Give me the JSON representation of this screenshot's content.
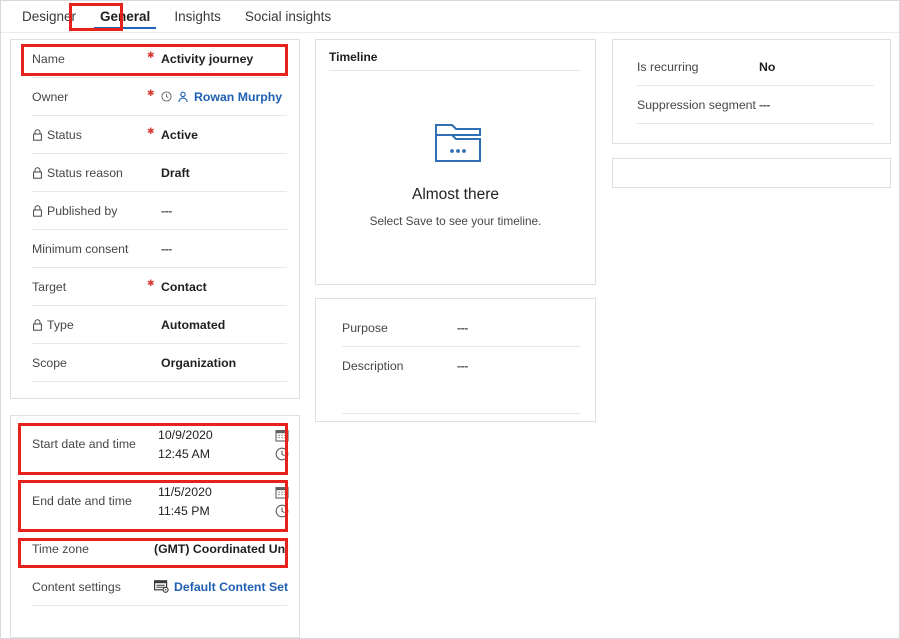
{
  "tabs": [
    {
      "label": "Designer",
      "active": false
    },
    {
      "label": "General",
      "active": true
    },
    {
      "label": "Insights",
      "active": false
    },
    {
      "label": "Social insights",
      "active": false
    }
  ],
  "general_card": {
    "fields": [
      {
        "label": "Name",
        "locked": false,
        "required": true,
        "value": "Activity journey",
        "style": "bold"
      },
      {
        "label": "Owner",
        "locked": false,
        "required": true,
        "value": "Rowan Murphy",
        "style": "link"
      },
      {
        "label": "Status",
        "locked": true,
        "required": true,
        "value": "Active",
        "style": "bold"
      },
      {
        "label": "Status reason",
        "locked": true,
        "required": false,
        "value": "Draft",
        "style": "bold"
      },
      {
        "label": "Published by",
        "locked": true,
        "required": false,
        "value": "---",
        "style": "muted"
      },
      {
        "label": "Minimum consent",
        "locked": false,
        "required": false,
        "value": "---",
        "style": "muted"
      },
      {
        "label": "Target",
        "locked": false,
        "required": true,
        "value": "Contact",
        "style": "bold"
      },
      {
        "label": "Type",
        "locked": true,
        "required": false,
        "value": "Automated",
        "style": "bold"
      },
      {
        "label": "Scope",
        "locked": false,
        "required": false,
        "value": "Organization",
        "style": "bold"
      }
    ]
  },
  "schedule_card": {
    "start": {
      "label": "Start date and time",
      "date": "10/9/2020",
      "time": "12:45 AM"
    },
    "end": {
      "label": "End date and time",
      "date": "11/5/2020",
      "time": "11:45 PM"
    },
    "timezone": {
      "label": "Time zone",
      "value": "(GMT) Coordinated Universal Time"
    },
    "content_settings": {
      "label": "Content settings",
      "value": "Default Content Set..."
    }
  },
  "timeline_card": {
    "title": "Timeline",
    "empty_heading": "Almost there",
    "empty_subtext": "Select Save to see your timeline."
  },
  "purpose_card": {
    "fields": [
      {
        "label": "Purpose",
        "value": "---"
      },
      {
        "label": "Description",
        "value": "---"
      }
    ]
  },
  "recurrence_card": {
    "fields": [
      {
        "label": "Is recurring",
        "value": "No",
        "style": "bold"
      },
      {
        "label": "Suppression segment",
        "value": "---",
        "style": "muted"
      }
    ]
  },
  "icons": {
    "lock": "lock-icon",
    "person": "person-icon",
    "recent": "recent-items-icon",
    "calendar": "calendar-icon",
    "clock": "clock-icon",
    "content_settings": "content-settings-icon",
    "folder": "folder-empty-icon"
  },
  "colors": {
    "accent": "#2266bb",
    "link": "#1f5fb3",
    "required": "#d6392f",
    "annotation": "#e8221b",
    "border": "#e1dfdd",
    "separator": "#e8e6e4"
  },
  "annotations": {
    "highlight_targets": [
      "General tab",
      "Name",
      "Start date and time",
      "End date and time",
      "Time zone"
    ]
  }
}
